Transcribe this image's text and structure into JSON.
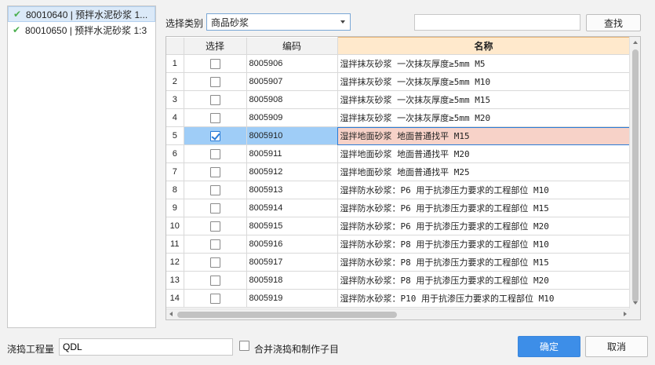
{
  "tree": {
    "items": [
      {
        "label": "80010640 | 预拌水泥砂浆 1...",
        "selected": true
      },
      {
        "label": "80010650 | 预拌水泥砂浆 1:3",
        "selected": false
      }
    ]
  },
  "filter": {
    "category_label": "选择类别",
    "category_value": "商品砂浆",
    "search_value": "",
    "find_label": "查找"
  },
  "grid": {
    "columns": [
      "",
      "选择",
      "编码",
      "名称"
    ],
    "rows": [
      {
        "num": "1",
        "checked": false,
        "code": "8005906",
        "name": "湿拌抹灰砂浆 一次抹灰厚度≥5mm M5"
      },
      {
        "num": "2",
        "checked": false,
        "code": "8005907",
        "name": "湿拌抹灰砂浆 一次抹灰厚度≥5mm M10"
      },
      {
        "num": "3",
        "checked": false,
        "code": "8005908",
        "name": "湿拌抹灰砂浆 一次抹灰厚度≥5mm M15"
      },
      {
        "num": "4",
        "checked": false,
        "code": "8005909",
        "name": "湿拌抹灰砂浆 一次抹灰厚度≥5mm M20"
      },
      {
        "num": "5",
        "checked": true,
        "code": "8005910",
        "name": "湿拌地面砂浆 地面普通找平 M15"
      },
      {
        "num": "6",
        "checked": false,
        "code": "8005911",
        "name": "湿拌地面砂浆 地面普通找平 M20"
      },
      {
        "num": "7",
        "checked": false,
        "code": "8005912",
        "name": "湿拌地面砂浆 地面普通找平 M25"
      },
      {
        "num": "8",
        "checked": false,
        "code": "8005913",
        "name": "湿拌防水砂浆：P6 用于抗渗压力要求的工程部位 M10"
      },
      {
        "num": "9",
        "checked": false,
        "code": "8005914",
        "name": "湿拌防水砂浆：P6 用于抗渗压力要求的工程部位 M15"
      },
      {
        "num": "10",
        "checked": false,
        "code": "8005915",
        "name": "湿拌防水砂浆：P6 用于抗渗压力要求的工程部位 M20"
      },
      {
        "num": "11",
        "checked": false,
        "code": "8005916",
        "name": "湿拌防水砂浆：P8 用于抗渗压力要求的工程部位 M10"
      },
      {
        "num": "12",
        "checked": false,
        "code": "8005917",
        "name": "湿拌防水砂浆：P8 用于抗渗压力要求的工程部位 M15"
      },
      {
        "num": "13",
        "checked": false,
        "code": "8005918",
        "name": "湿拌防水砂浆：P8 用于抗渗压力要求的工程部位 M20"
      },
      {
        "num": "14",
        "checked": false,
        "code": "8005919",
        "name": "湿拌防水砂浆：P10 用于抗渗压力要求的工程部位 M10"
      }
    ],
    "selected_row": 5
  },
  "footer": {
    "qty_label": "浇捣工程量",
    "qty_value": "QDL",
    "merge_label": "合并浇捣和制作子目",
    "merge_checked": false,
    "ok_label": "确定",
    "cancel_label": "取消"
  },
  "colors": {
    "accent": "#3d8ee8",
    "check_green": "#4caf50",
    "header_highlight": "#ffe9cc",
    "selected_cell": "#9fcdf7",
    "selected_name_cell": "#f7d2c8"
  }
}
